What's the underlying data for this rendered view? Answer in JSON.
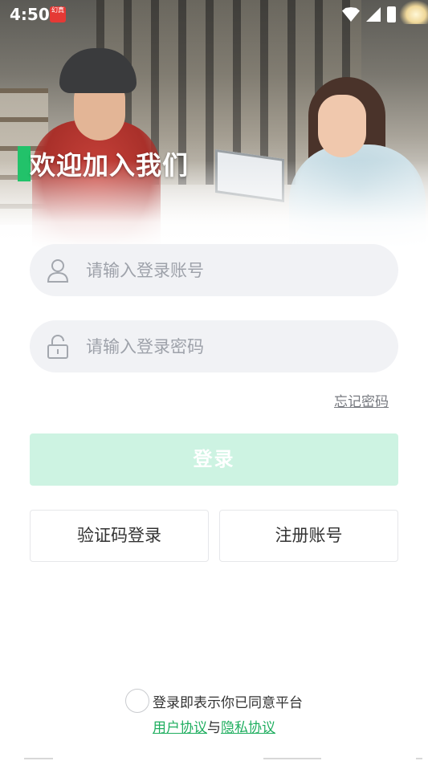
{
  "status_bar": {
    "time": "4:50",
    "app_icon_text": "幻真"
  },
  "hero": {
    "welcome_text": "欢迎加入我们",
    "accent_color": "#22c26a"
  },
  "form": {
    "account_placeholder": "请输入登录账号",
    "password_placeholder": "请输入登录密码",
    "forgot_password": "忘记密码",
    "login_button": "登录",
    "code_login_button": "验证码登录",
    "register_button": "注册账号"
  },
  "agreement": {
    "text": "登录即表示你已同意平台",
    "user_agreement": "用户协议",
    "connector": "与",
    "privacy_agreement": "隐私协议",
    "link_color": "#1fae5f"
  },
  "icons": {
    "account": "user-icon",
    "password": "lock-icon",
    "wifi": "wifi-icon",
    "signal": "signal-icon",
    "battery": "battery-charging-icon"
  }
}
